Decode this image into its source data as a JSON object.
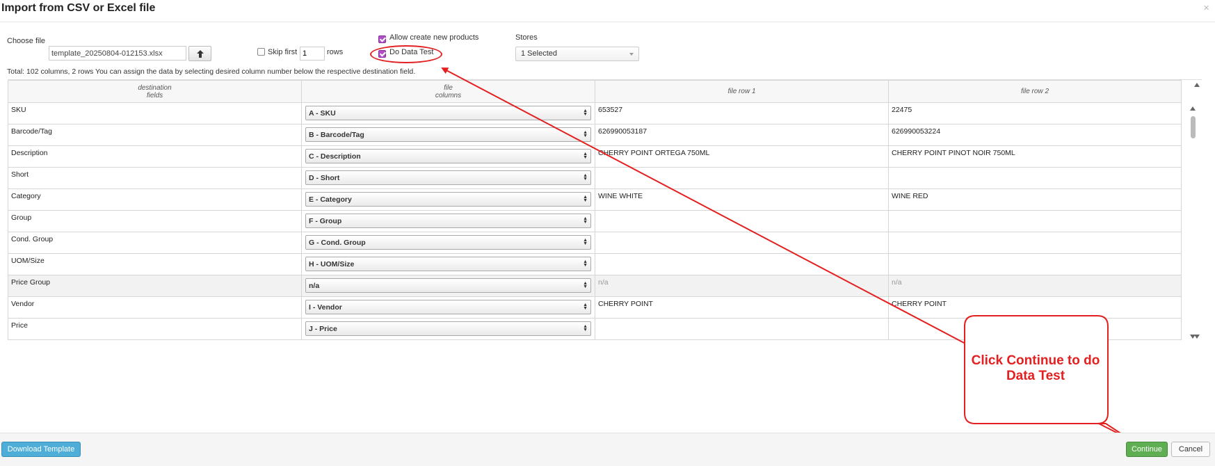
{
  "dialog": {
    "title": "Import from CSV or Excel file"
  },
  "controls": {
    "choose_file_label": "Choose file",
    "file_value": "template_20250804-012153.xlsx",
    "skip_first_label": "Skip first",
    "skip_first_value": "1",
    "rows_label": "rows",
    "allow_create_label": "Allow create new products",
    "allow_create_checked": true,
    "do_data_test_label": "Do Data Test",
    "do_data_test_checked": true,
    "stores_label": "Stores",
    "stores_value": "1 Selected"
  },
  "info_text": "Total: 102 columns, 2 rows You can assign the data by selecting desired column number below the respective destination field.",
  "grid": {
    "headers": {
      "dest_line1": "destination",
      "dest_line2": "fields",
      "file_line1": "file",
      "file_line2": "columns",
      "row1": "file row 1",
      "row2": "file row 2"
    },
    "rows": [
      {
        "field": "SKU",
        "column": "A - SKU",
        "row1": "653527",
        "row2": "22475"
      },
      {
        "field": "Barcode/Tag",
        "column": "B - Barcode/Tag",
        "row1": "626990053187",
        "row2": "626990053224"
      },
      {
        "field": "Description",
        "column": "C - Description",
        "row1": "CHERRY POINT ORTEGA 750ML",
        "row2": "CHERRY POINT PINOT NOIR 750ML"
      },
      {
        "field": "Short",
        "column": "D - Short",
        "row1": "",
        "row2": ""
      },
      {
        "field": "Category",
        "column": "E - Category",
        "row1": "WINE WHITE",
        "row2": "WINE RED"
      },
      {
        "field": "Group",
        "column": "F - Group",
        "row1": "",
        "row2": ""
      },
      {
        "field": "Cond. Group",
        "column": "G - Cond. Group",
        "row1": "",
        "row2": ""
      },
      {
        "field": "UOM/Size",
        "column": "H - UOM/Size",
        "row1": "",
        "row2": ""
      },
      {
        "field": "Price Group",
        "column": "n/a",
        "row1": "n/a",
        "row2": "n/a"
      },
      {
        "field": "Vendor",
        "column": "I - Vendor",
        "row1": "CHERRY POINT",
        "row2": "CHERRY POINT"
      },
      {
        "field": "Price",
        "column": "J - Price",
        "row1": "",
        "row2": ""
      }
    ]
  },
  "footer": {
    "download_label": "Download Template",
    "continue_label": "Continue",
    "cancel_label": "Cancel"
  },
  "annotation": {
    "callout_line1": "Click Continue to do",
    "callout_line2": "Data Test",
    "color": "#e41f1f"
  }
}
